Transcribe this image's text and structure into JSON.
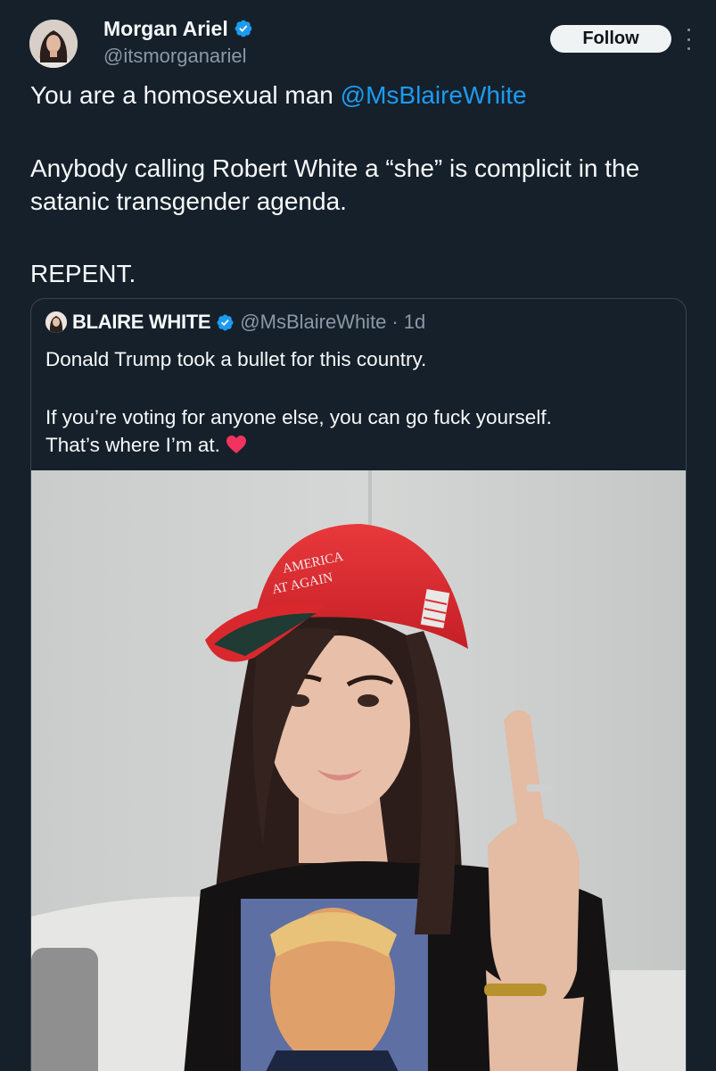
{
  "author": {
    "display_name": "Morgan Ariel",
    "handle": "@itsmorganariel",
    "verified_icon": "verified-badge-icon"
  },
  "actions": {
    "follow_label": "Follow",
    "more_icon": "more-vertical-icon"
  },
  "tweet": {
    "line1_text": "You are a homosexual man ",
    "line1_mention": "@MsBlaireWhite",
    "paragraph2": "Anybody calling Robert White a “she” is complicit in the satanic transgender agenda.",
    "paragraph3": "REPENT."
  },
  "quoted": {
    "display_name": "BLAIRE WHITE",
    "handle": "@MsBlaireWhite",
    "separator": "·",
    "time": "1d",
    "line1": "Donald Trump took a bullet for this country.",
    "line2": "If you’re voting for anyone else, you can go fuck yourself.",
    "line3": "That’s where I’m at.",
    "emoji_icon": "red-heart-icon",
    "image_caption": [
      "AMERICA",
      "AT AGAIN"
    ]
  },
  "colors": {
    "background": "#15202b",
    "accent": "#1d9bf0",
    "text_secondary": "#8b98a5",
    "border": "#38444d"
  }
}
